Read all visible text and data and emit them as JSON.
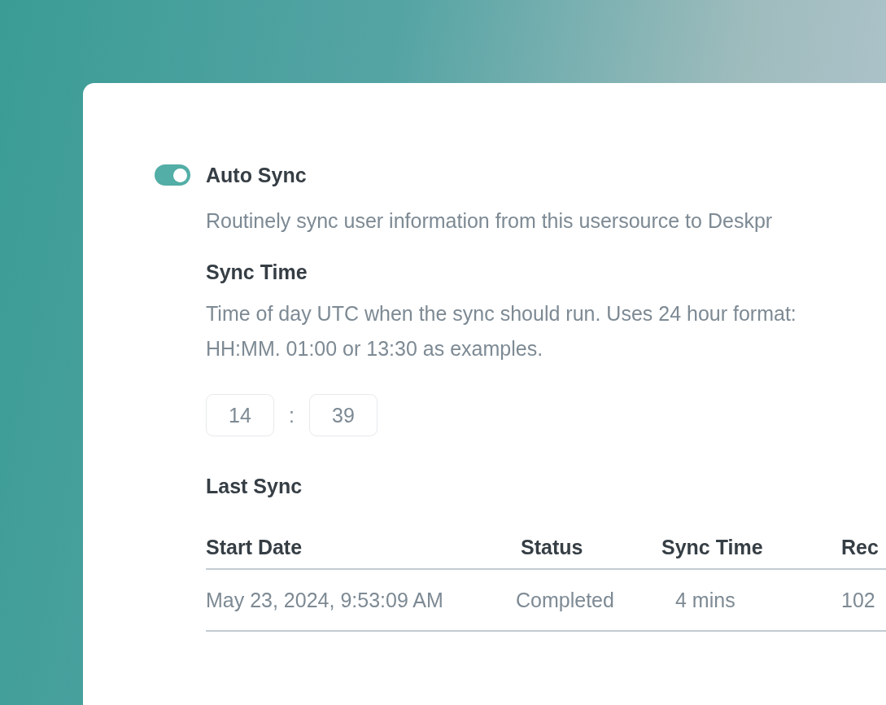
{
  "auto_sync": {
    "on": true,
    "label": "Auto Sync",
    "description": "Routinely sync user information from this usersource to Deskpr"
  },
  "sync_time": {
    "label": "Sync Time",
    "description": "Time of day UTC when the sync should run. Uses 24 hour format: HH:MM. 01:00 or 13:30 as examples.",
    "hours": "14",
    "separator": ":",
    "minutes": "39"
  },
  "last_sync": {
    "label": "Last Sync",
    "table": {
      "columns": [
        "Start Date",
        "Status",
        "Sync Time",
        "Rec"
      ],
      "rows": [
        [
          "May 23, 2024, 9:53:09 AM",
          "Completed",
          "4 mins",
          "102"
        ]
      ]
    }
  }
}
